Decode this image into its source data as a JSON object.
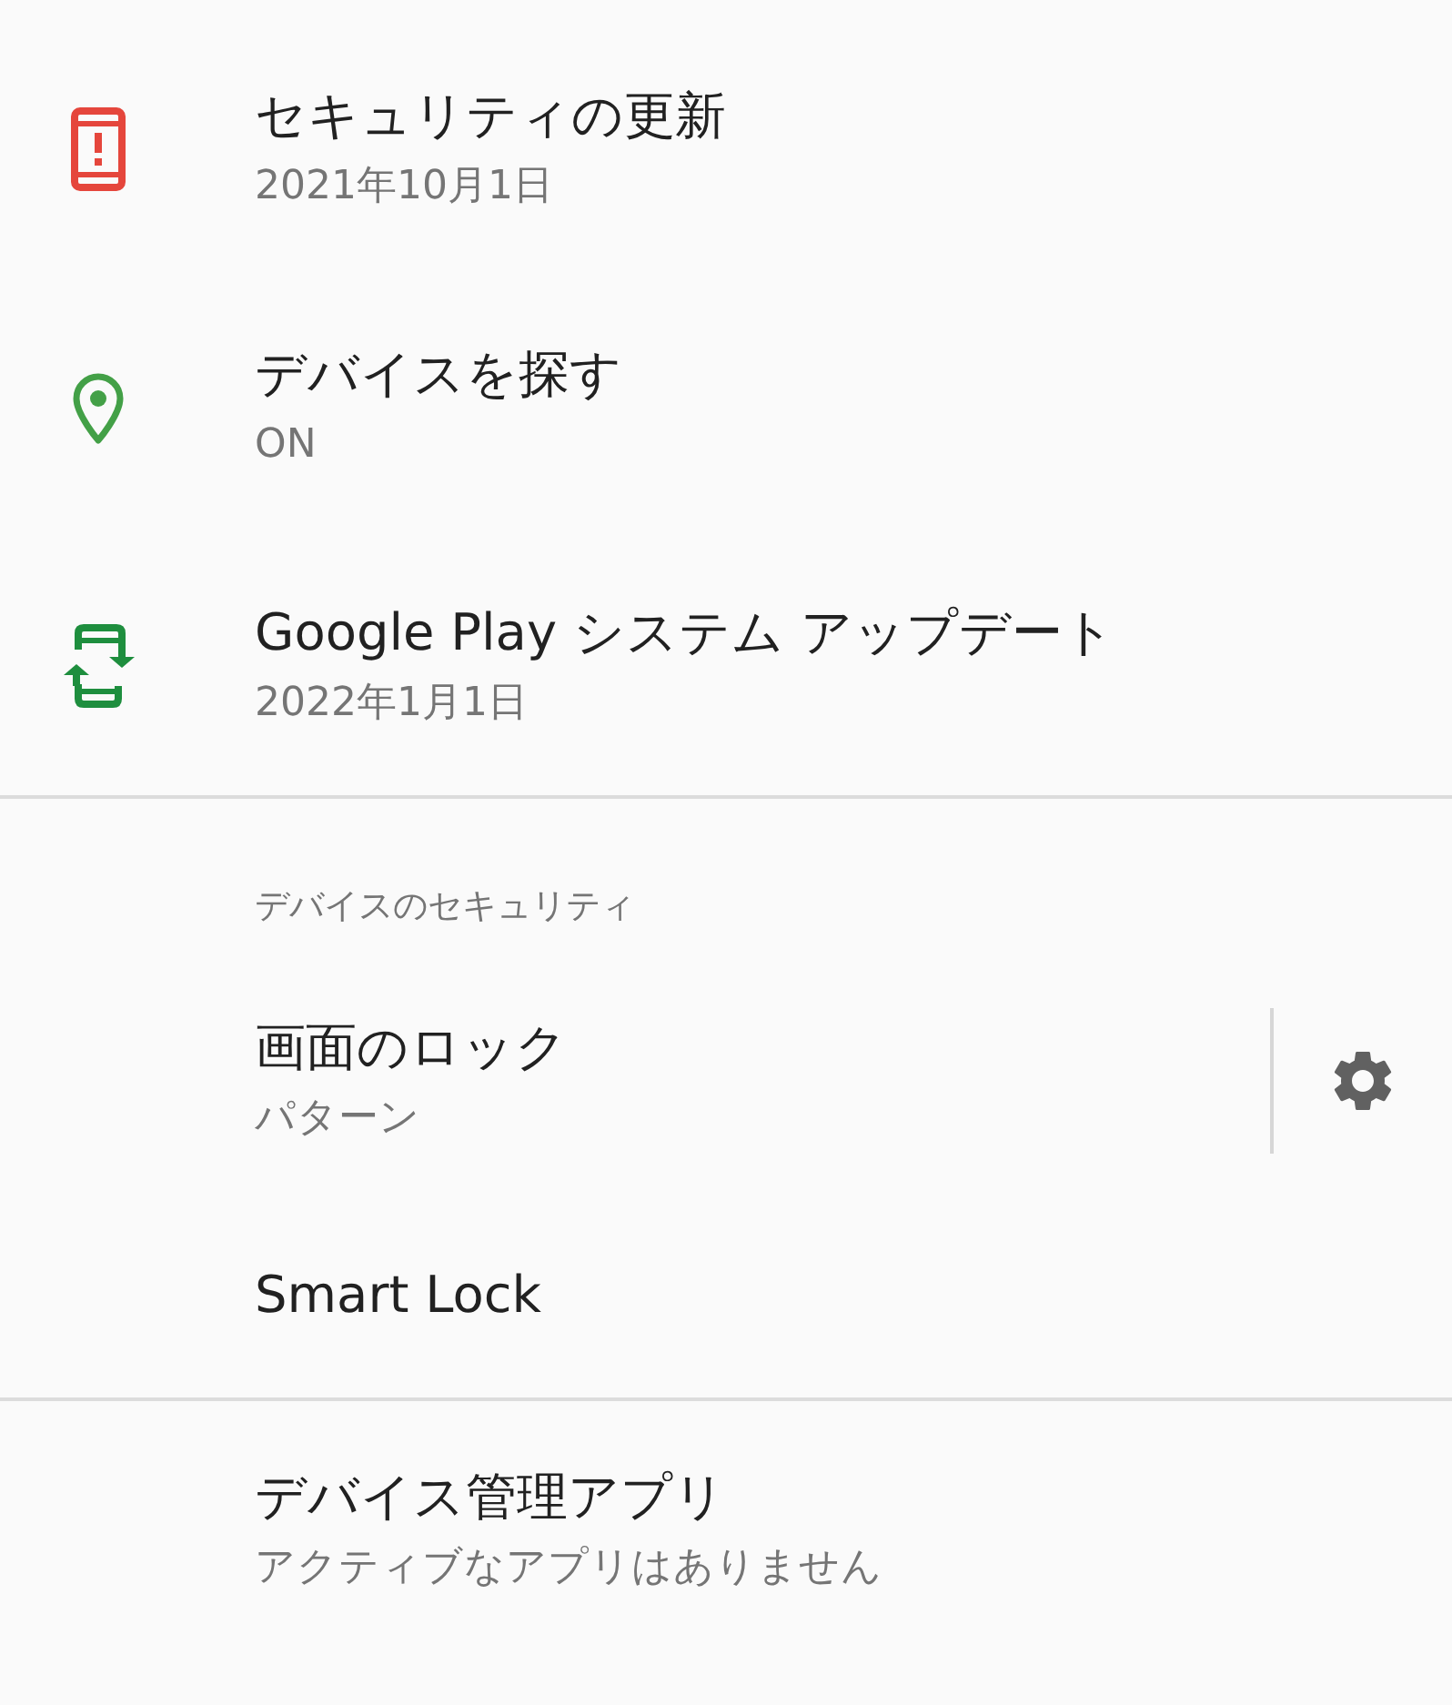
{
  "sections": [
    {
      "items": [
        {
          "kind": "alert",
          "title": "セキュリティの更新",
          "subtitle": "2021年10月1日",
          "settings_button": false
        },
        {
          "kind": "location",
          "title": "デバイスを探す",
          "subtitle": "ON",
          "settings_button": false
        },
        {
          "kind": "update",
          "title": "Google Play システム アップデート",
          "subtitle": "2022年1月1日",
          "settings_button": false
        }
      ]
    },
    {
      "header": "デバイスのセキュリティ",
      "items": [
        {
          "kind": "plain",
          "title": "画面のロック",
          "subtitle": "パターン",
          "settings_button": true
        },
        {
          "kind": "plain",
          "title": "Smart Lock",
          "settings_button": false
        }
      ]
    },
    {
      "items": [
        {
          "kind": "plain",
          "title": "デバイス管理アプリ",
          "subtitle": "アクティブなアプリはありません",
          "settings_button": false
        }
      ]
    }
  ]
}
